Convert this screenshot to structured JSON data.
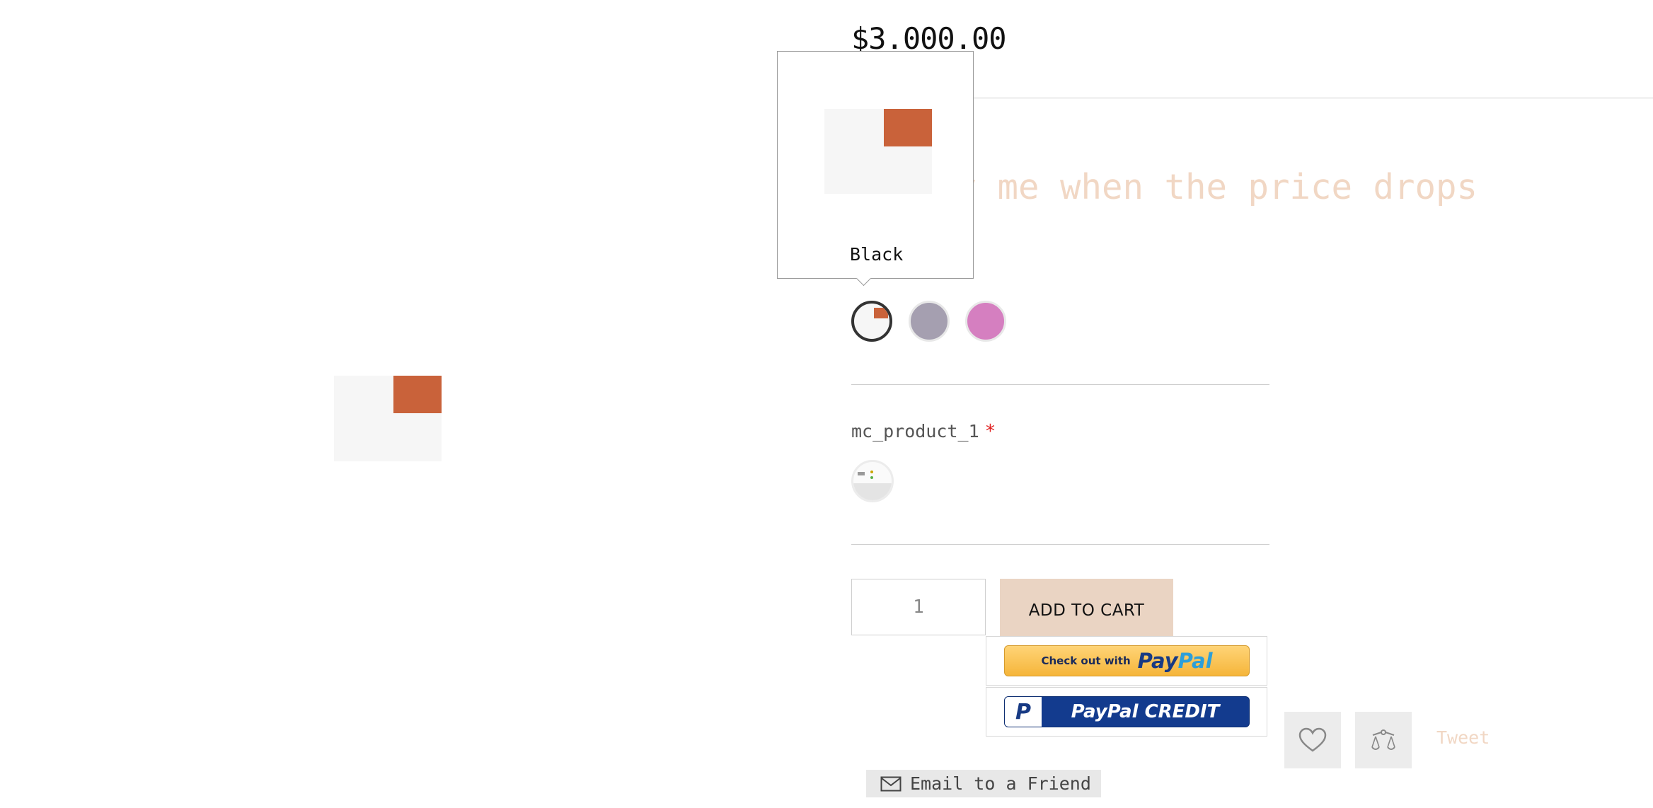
{
  "product": {
    "price": "$3.000.00",
    "notify_text": "Notify me when the price drops",
    "image_alt": "product image"
  },
  "color_option": {
    "tooltip_label": "Black",
    "swatches": [
      {
        "name": "Black",
        "color": "#f6f6f6",
        "selected": true
      },
      {
        "name": "Grey",
        "color": "#a59fb0",
        "selected": false
      },
      {
        "name": "Pink",
        "color": "#d57fc0",
        "selected": false
      }
    ]
  },
  "custom_option": {
    "label": "mc_product_1",
    "required_mark": "*"
  },
  "cart": {
    "quantity": "1",
    "add_to_cart_label": "ADD TO CART"
  },
  "paypal": {
    "checkout_prefix": "Check out with",
    "checkout_pay": "Pay",
    "checkout_pal": "Pal",
    "credit_mark": "P",
    "credit_label": "PayPal CREDIT"
  },
  "social": {
    "tweet_label": "Tweet",
    "email_friend_label": "Email to a Friend"
  },
  "colors": {
    "accent_peach": "#ead4c3",
    "muted_peach_text": "#f1d7c4",
    "patch_orange": "#c9623a",
    "required_red": "#e02020"
  }
}
